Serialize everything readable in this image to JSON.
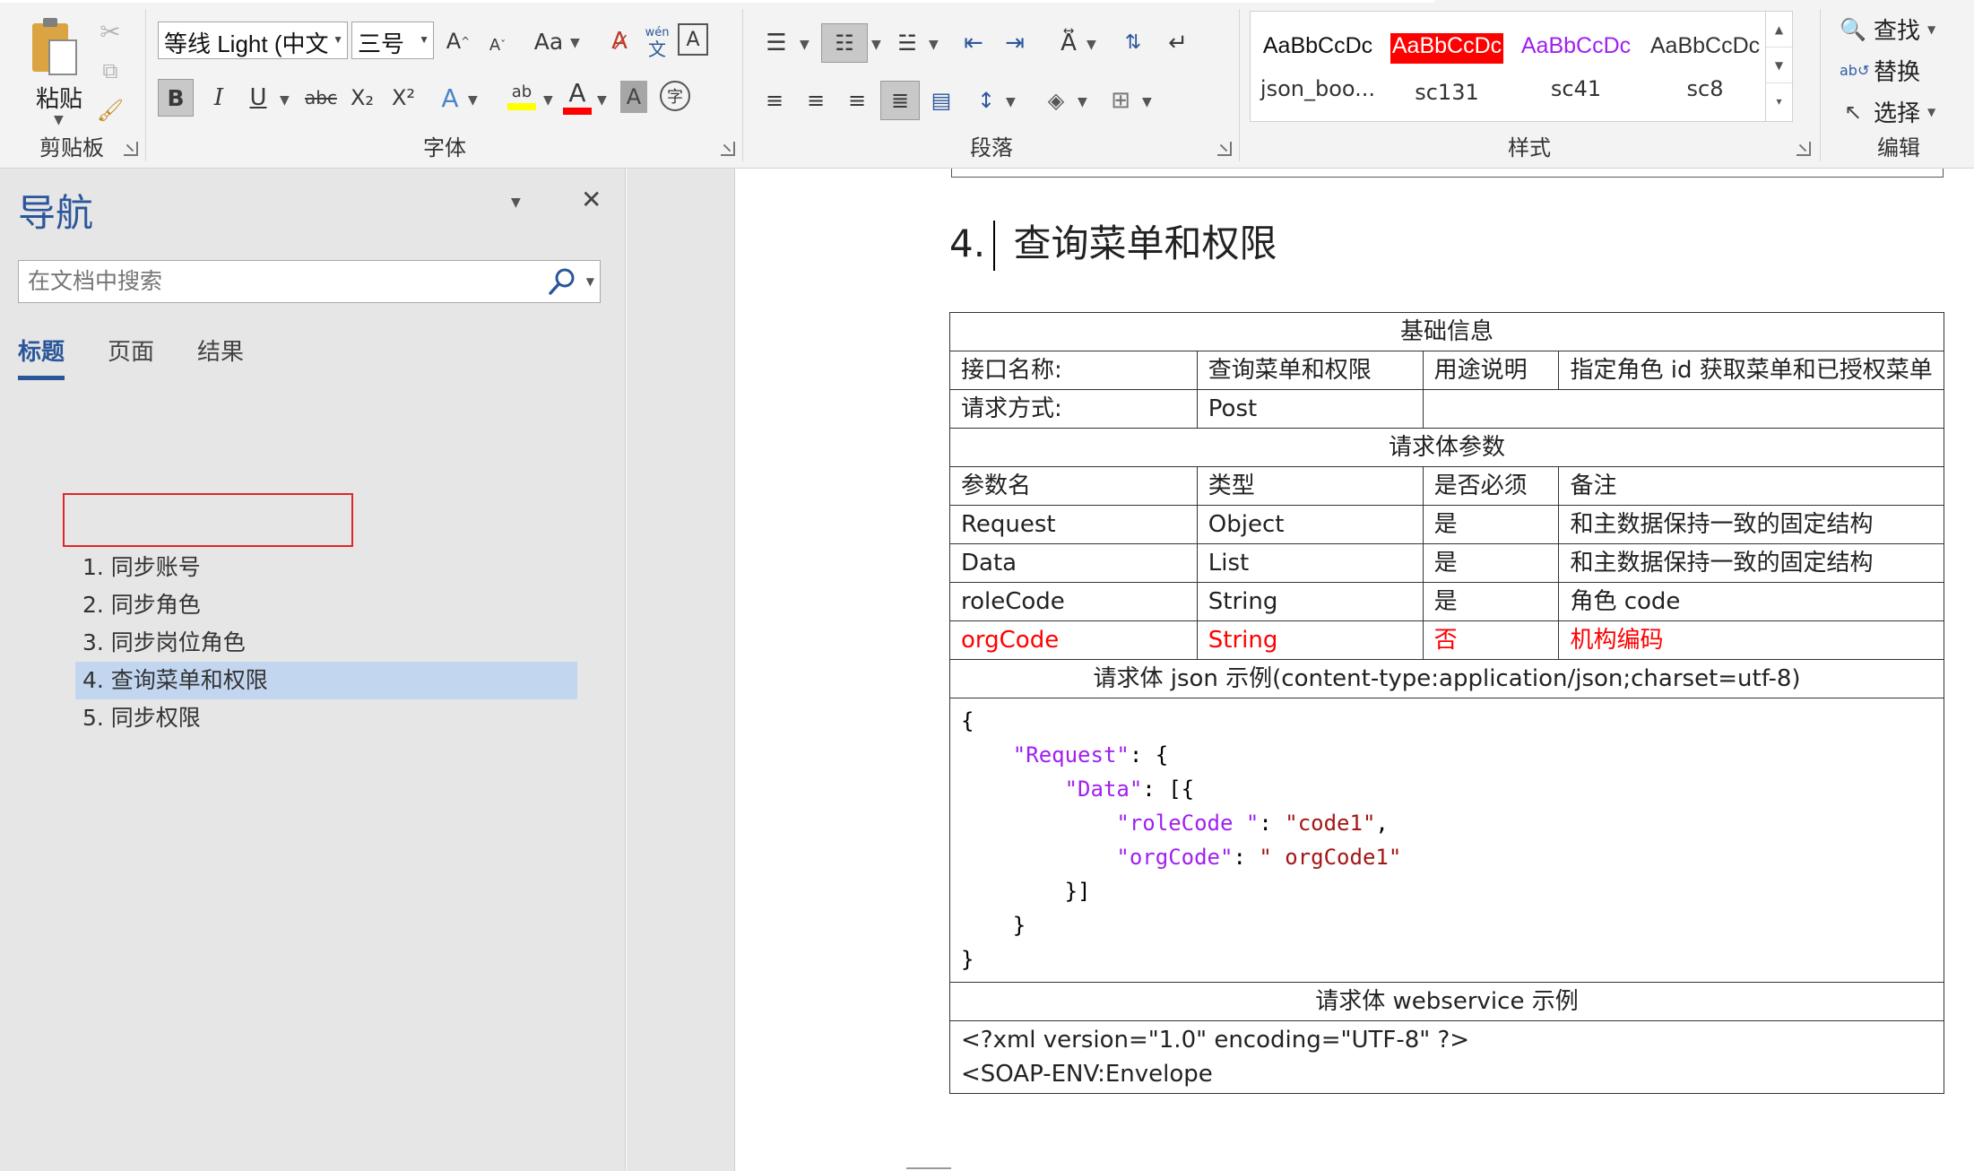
{
  "ribbon": {
    "clipboard": {
      "paste_label": "粘贴",
      "group_label": "剪贴板"
    },
    "font": {
      "font_name": "等线 Light (中文",
      "font_size": "三号",
      "group_label": "字体",
      "grow_label": "A",
      "shrink_label": "A",
      "case_label": "Aa",
      "bold_label": "B",
      "italic_label": "I",
      "underline_label": "U",
      "strike_label": "abc",
      "sub_label": "X₂",
      "sup_label": "X²",
      "phonetic_top": "wén",
      "phonetic_bottom": "文",
      "border_char": "A",
      "effects_label": "A",
      "highlight_label": "ab",
      "font_color_label": "A",
      "shading_label": "A",
      "enclose_label": "字",
      "highlight_color": "#ffff00",
      "font_color": "#ff0000"
    },
    "paragraph": {
      "group_label": "段落"
    },
    "styles": {
      "group_label": "样式",
      "items": [
        {
          "sample": "AaBbCcDc",
          "name": "json_boo...",
          "color": "#111111",
          "bg": ""
        },
        {
          "sample": "AaBbCcDc",
          "name": "sc131",
          "color": "#ffffff",
          "bg": "#ff0000"
        },
        {
          "sample": "AaBbCcDc",
          "name": "sc41",
          "color": "#a020f0",
          "bg": ""
        },
        {
          "sample": "AaBbCcDc",
          "name": "sc8",
          "color": "#333333",
          "bg": ""
        }
      ]
    },
    "editing": {
      "group_label": "编辑",
      "find_label": "查找",
      "replace_label": "替换",
      "select_label": "选择"
    }
  },
  "nav": {
    "title": "导航",
    "search_placeholder": "在文档中搜索",
    "tabs": [
      {
        "label": "标题",
        "active": true
      },
      {
        "label": "页面",
        "active": false
      },
      {
        "label": "结果",
        "active": false
      }
    ],
    "headings": [
      {
        "label": "1. 同步账号",
        "selected": false
      },
      {
        "label": "2. 同步角色",
        "selected": false
      },
      {
        "label": "3. 同步岗位角色",
        "selected": false
      },
      {
        "label": "4. 查询菜单和权限",
        "selected": true
      },
      {
        "label": "5. 同步权限",
        "selected": false
      }
    ]
  },
  "document": {
    "heading_num": "4.",
    "heading_text": "查询菜单和权限",
    "table": {
      "basic_info": "基础信息",
      "api_name_label": "接口名称:",
      "api_name_value": "查询菜单和权限",
      "purpose_label": "用途说明",
      "purpose_value": "指定角色 id 获取菜单和已授权菜单",
      "method_label": "请求方式:",
      "method_value": "Post",
      "body_params": "请求体参数",
      "param_headers": [
        "参数名",
        "类型",
        "是否必须",
        "备注"
      ],
      "params": [
        {
          "name": "Request",
          "type": "Object",
          "required": "是",
          "note": "和主数据保持一致的固定结构",
          "highlight": false
        },
        {
          "name": "Data",
          "type": "List",
          "required": "是",
          "note": "和主数据保持一致的固定结构",
          "highlight": false
        },
        {
          "name": "roleCode",
          "type": "String",
          "required": "是",
          "note": "角色 code",
          "highlight": false
        },
        {
          "name": "orgCode",
          "type": "String",
          "required": "否",
          "note": "机构编码",
          "highlight": true
        }
      ],
      "json_example_title": "请求体 json 示例(content-type:application/json;charset=utf-8)",
      "json_lines": {
        "l1": "{",
        "l2_key": "\"Request\"",
        "l2_rest": ": {",
        "l3_key": "\"Data\"",
        "l3_rest": ": [{",
        "l4_key": "\"roleCode \"",
        "l4_sep": ": ",
        "l4_val": "\"code1\"",
        "l4_end": ",",
        "l5_key": "\"orgCode\"",
        "l5_sep": ": ",
        "l5_val": "\" orgCode1\"",
        "l6": "}]",
        "l7": "}",
        "l8": "}"
      },
      "ws_example_title": "请求体 webservice 示例",
      "xml_line1": "<?xml version=\"1.0\" encoding=\"UTF-8\" ?>",
      "xml_line2": "<SOAP-ENV:Envelope"
    }
  }
}
